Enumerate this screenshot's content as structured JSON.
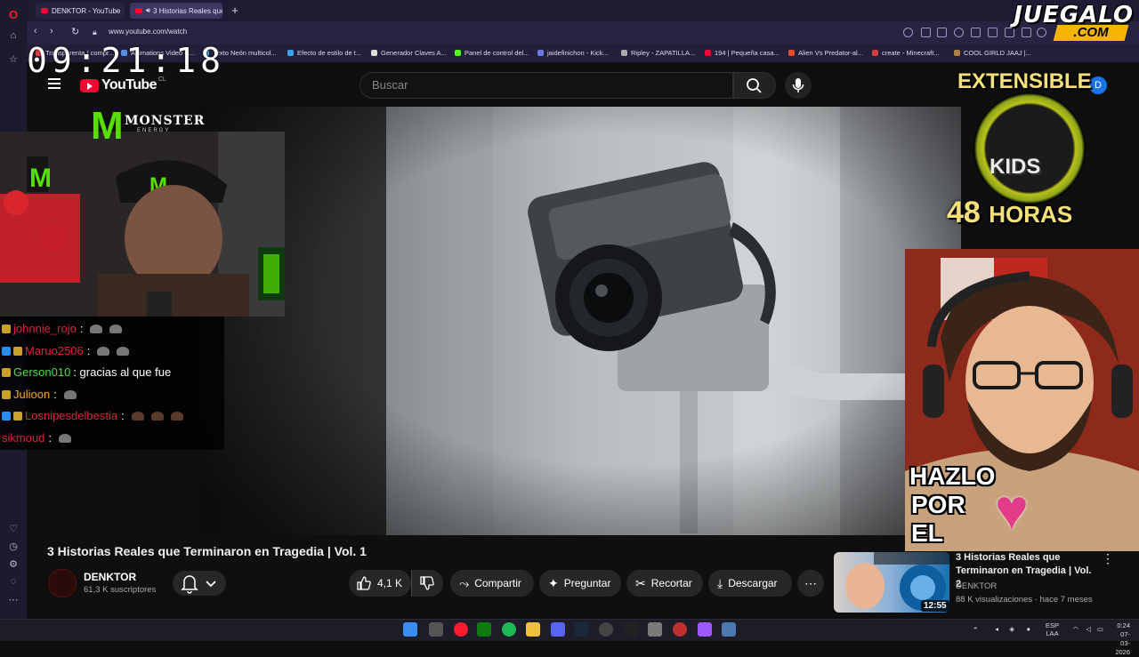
{
  "browser": {
    "tabs": [
      {
        "label": "DENKTOR - YouTube"
      },
      {
        "label": "3 Historias Reales que"
      }
    ],
    "new_tab_symbol": "+",
    "url": "www.youtube.com/watch",
    "bookmarks": [
      {
        "label": "Transparenta / compr..."
      },
      {
        "label": "Animations Video C..."
      },
      {
        "label": "Texto Neón multicol..."
      },
      {
        "label": "Efecto de estilo de t..."
      },
      {
        "label": "Generador Claves A..."
      },
      {
        "label": "Panel de control del..."
      },
      {
        "label": "jaidefinichon - Kick..."
      },
      {
        "label": "Ripley - ZAPATILLA..."
      },
      {
        "label": "194 | Pequeña casa..."
      },
      {
        "label": "Alien Vs Predator-al..."
      },
      {
        "label": "create - Minecraft..."
      },
      {
        "label": "COOL GIRLD JAAJ |..."
      }
    ]
  },
  "overlay": {
    "clock": "09:21:18",
    "brand_line1": "JUEGALO",
    "brand_line2": ".COM",
    "monster_name": "MONSTER",
    "monster_sub": "ENERGY",
    "extensible_title": "EXTENSIBLE",
    "extensible_kids": "KIDS",
    "extensible_hours_num": "48",
    "extensible_hours_word": "HORAS",
    "hazlo": [
      "HAZLO",
      "POR",
      "EL"
    ]
  },
  "chat": [
    {
      "user": "johnnie_rojo",
      "msg": ":",
      "color": "#e0203a"
    },
    {
      "user": "Maruo2506",
      "msg": ":",
      "color": "#e0203a"
    },
    {
      "user": "Gerson010",
      "msg": ": gracias al que fue",
      "color": "#4ade40"
    },
    {
      "user": "Julioon",
      "msg": ":",
      "color": "#f5a623"
    },
    {
      "user": "Losnipesdelbestia",
      "msg": ":",
      "color": "#e0203a"
    },
    {
      "user": "sikmoud",
      "msg": ":",
      "color": "#e0203a"
    }
  ],
  "youtube": {
    "logo_text": "YouTube",
    "region": "CL",
    "search_placeholder": "Buscar",
    "avatar_letter": "D",
    "video_title": "3 Historias Reales que Terminaron en Tragedia | Vol. 1",
    "channel": "DENKTOR",
    "subscribers": "61,3 K suscriptores",
    "likes": "4,1 K",
    "actions": {
      "share": "Compartir",
      "ask": "Preguntar",
      "clip": "Recortar",
      "download": "Descargar"
    },
    "recommended": {
      "title": "3 Historias Reales que Terminaron en Tragedia | Vol. 2",
      "channel": "DENKTOR",
      "meta": "88 K visualizaciones · hace 7 meses",
      "duration": "12:55"
    }
  },
  "taskbar": {
    "lang": "ESP",
    "lang2": "LAA",
    "time": "0:24",
    "date": "07-03-2026"
  },
  "colors": {
    "accent": "#ff0033",
    "monster_green": "#56e000",
    "juegalo_yellow": "#f5b400"
  }
}
